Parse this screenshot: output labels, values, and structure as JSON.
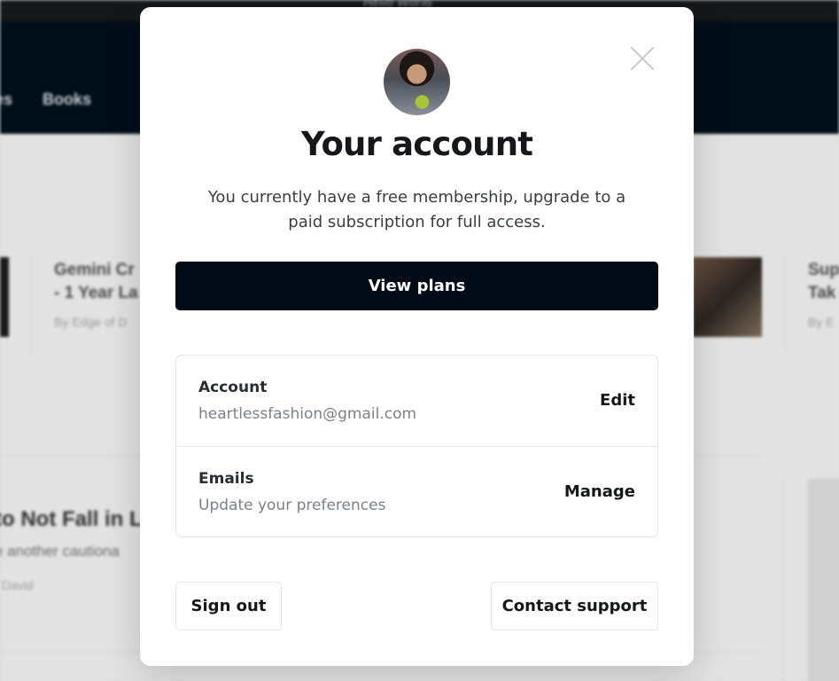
{
  "background": {
    "topbar_text": "Hello World",
    "nav": [
      "es",
      "Books"
    ],
    "cards": [
      {
        "title": "Gemini Cr",
        "title2": "- 1 Year La",
        "byline": "By Edge of D"
      },
      {
        "title": "Sup",
        "title2": "Tak",
        "byline": "By E"
      }
    ],
    "article": {
      "title": "to Not Fall in L",
      "subtitle": "e another cautiona",
      "byline": "f David"
    }
  },
  "modal": {
    "title": "Your account",
    "description": "You currently have a free membership, upgrade to a paid subscription for full access.",
    "primary_button": "View plans",
    "rows": [
      {
        "label": "Account",
        "value": "heartlessfashion@gmail.com",
        "action": "Edit"
      },
      {
        "label": "Emails",
        "value": "Update your preferences",
        "action": "Manage"
      }
    ],
    "sign_out": "Sign out",
    "contact_support": "Contact support"
  }
}
